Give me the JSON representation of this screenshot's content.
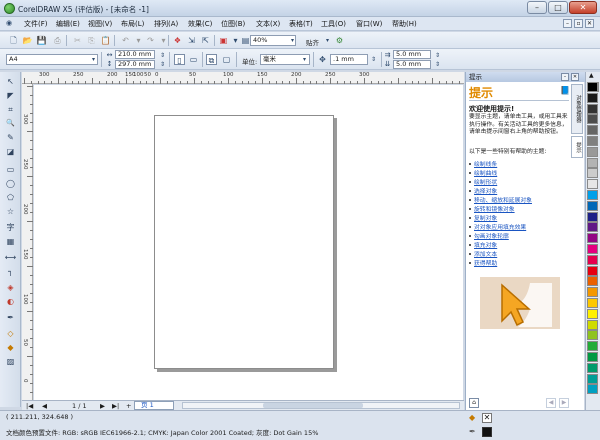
{
  "window": {
    "title": "CorelDRAW X5 (评估版) - [未命名 -1]",
    "min": "–",
    "max": "□",
    "close": "✕"
  },
  "menu": [
    "文件(F)",
    "编辑(E)",
    "视图(V)",
    "布局(L)",
    "排列(A)",
    "效果(C)",
    "位图(B)",
    "文本(X)",
    "表格(T)",
    "工具(O)",
    "窗口(W)",
    "帮助(H)"
  ],
  "toolbar1": {
    "zoom": "40%",
    "snap_label": "贴齐"
  },
  "toolbar2": {
    "page_size": "A4",
    "width": "210.0 mm",
    "height": "297.0 mm",
    "unit_label": "单位:",
    "unit": "毫米",
    "nudge": ".1 mm",
    "dup_x": "5.0 mm",
    "dup_y": "5.0 mm"
  },
  "ruler": {
    "h": [
      "300",
      "250",
      "200",
      "150",
      "100",
      "50",
      "0",
      "50",
      "100",
      "150",
      "200",
      "250",
      "300"
    ],
    "v": [
      "300",
      "250",
      "200",
      "150",
      "100",
      "50",
      "0"
    ]
  },
  "tools": [
    "pick-tool",
    "shape-tool",
    "crop-tool",
    "zoom-tool",
    "freehand-tool",
    "smart-fill-tool",
    "rectangle-tool",
    "ellipse-tool",
    "polygon-tool",
    "basic-shapes-tool",
    "text-tool",
    "table-tool",
    "dimension-tool",
    "connector-tool",
    "blend-tool",
    "transparency-tool",
    "eyedropper-tool",
    "outline-tool",
    "fill-tool",
    "interactive-fill-tool"
  ],
  "tool_glyphs": [
    "↖",
    "◤",
    "⌗",
    "🔍",
    "✎",
    "◪",
    "▭",
    "◯",
    "⬠",
    "☆",
    "字",
    "▦",
    "⟷",
    "┐",
    "◈",
    "◐",
    "✒",
    "◇",
    "◆",
    "▨"
  ],
  "page_nav": {
    "first": "|◀",
    "prev": "◀",
    "current": "1 / 1",
    "next": "▶",
    "last": "▶|",
    "add": "+",
    "tab": "页 1"
  },
  "docker": {
    "header": "提示",
    "title": "提示",
    "welcome": "欢迎使用提示!",
    "intro": "要显示主题，请单击工具，或用工具来执行操作。有关活动工具的更多信息，请单击提示间窗右上角的帮助按钮。",
    "list_intro": "以下是一些特别有帮助的主题:",
    "links": [
      "绘制线条",
      "绘制曲线",
      "绘制形状",
      "选择对象",
      "移动、缩放和延展对象",
      "旋转和镜像对象",
      "复制对象",
      "对对象应用填充效果",
      "勾画对象轮廓",
      "填充对象",
      "添加文本",
      "获得帮助"
    ],
    "side_tabs": [
      "对象管理器",
      "提示"
    ]
  },
  "palette": {
    "colors": [
      "#ffffff",
      "#000000",
      "#1a1a1a",
      "#333333",
      "#4d4d4d",
      "#666666",
      "#808080",
      "#999999",
      "#b3b3b3",
      "#cccccc",
      "#e6e6e6",
      "#00a0e9",
      "#0068b7",
      "#1d2088",
      "#601986",
      "#920783",
      "#e4007f",
      "#e5004f",
      "#e60012",
      "#eb6100",
      "#f39800",
      "#fcc800",
      "#fff100",
      "#cfdb00",
      "#8fc31f",
      "#22ac38",
      "#009944",
      "#009b6b",
      "#009e96",
      "#00a0c1"
    ]
  },
  "status": {
    "coords": "( 211.211, 324.648 )",
    "profile": "文档颜色预置文件: RGB: sRGB IEC61966-2.1; CMYK: Japan Color 2001 Coated; 灰度: Dot Gain 15%"
  }
}
